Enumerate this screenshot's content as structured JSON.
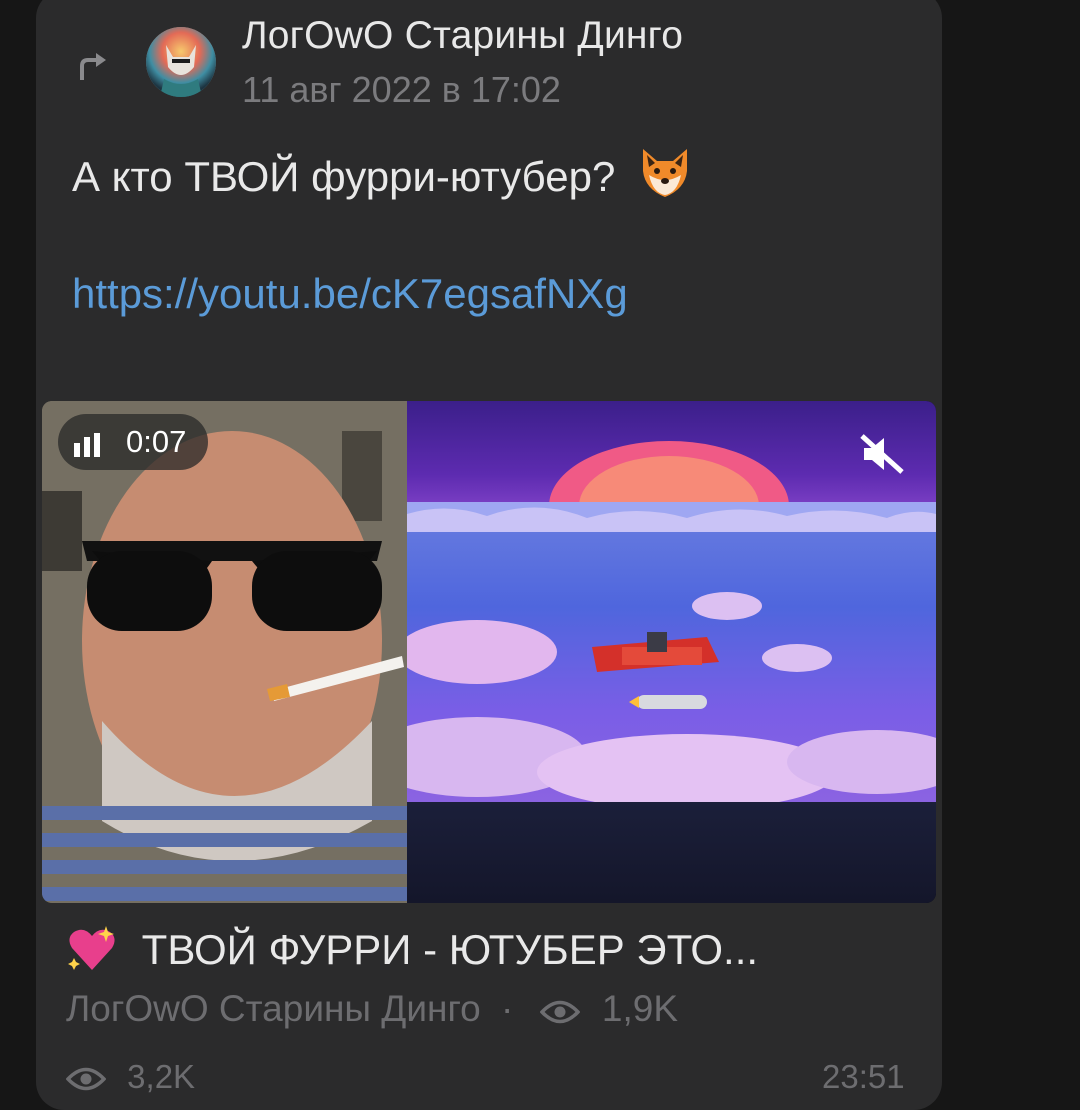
{
  "post": {
    "author": "ЛогOwO Старины Динго",
    "date": "11 авг 2022 в 17:02",
    "text": "А кто ТВОЙ фурри-ютубер?",
    "text_emoji_icon": "fox-face-icon",
    "link": "https://youtu.be/cK7egsafNXg"
  },
  "video": {
    "duration": "0:07",
    "title": "ТВОЙ ФУРРИ - ЮТУБЕР ЭТО...",
    "title_emoji_icon": "sparkling-heart-icon",
    "channel": "ЛогOwO Старины Динго",
    "separator": "·",
    "views": "1,9K"
  },
  "footer": {
    "views": "3,2K",
    "time": "23:51"
  },
  "colors": {
    "background": "#161616",
    "card": "#2b2b2c",
    "link": "#5b9bd8",
    "muted_text": "#6d6d70"
  }
}
